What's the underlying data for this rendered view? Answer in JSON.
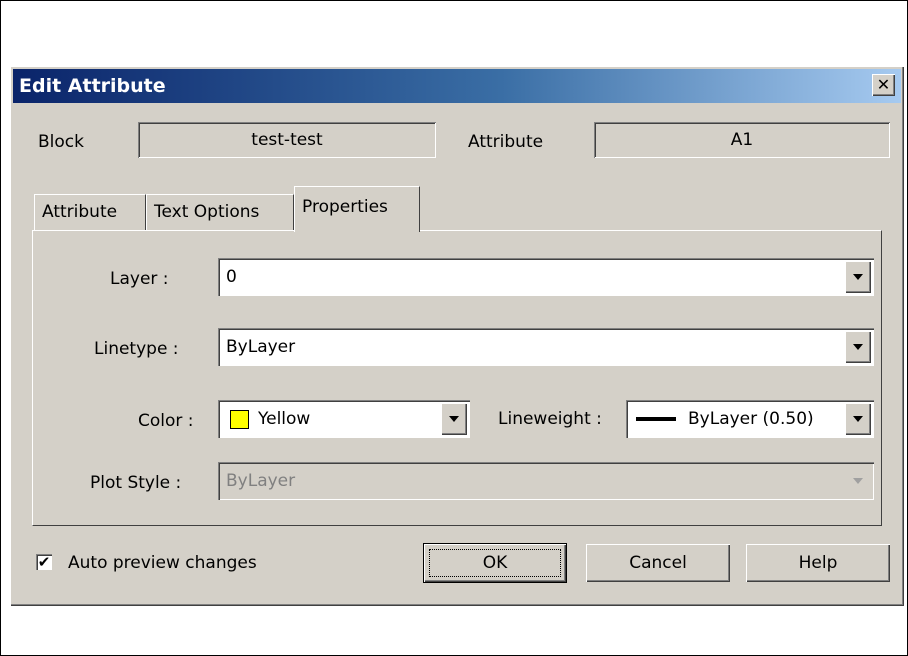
{
  "dialog": {
    "title": "Edit Attribute",
    "close_glyph": "✕"
  },
  "block": {
    "label": "Block",
    "value": "test-test"
  },
  "attribute": {
    "label": "Attribute",
    "value": "A1"
  },
  "tabs": [
    {
      "label": "Attribute",
      "active": false
    },
    {
      "label": "Text Options",
      "active": false
    },
    {
      "label": "Properties",
      "active": true
    }
  ],
  "properties": {
    "layer": {
      "label": "Layer :",
      "value": "0"
    },
    "linetype": {
      "label": "Linetype :",
      "value": "ByLayer"
    },
    "color": {
      "label": "Color :",
      "value": "Yellow",
      "swatch": "#ffff00"
    },
    "lineweight": {
      "label": "Lineweight :",
      "value": "ByLayer (0.50)"
    },
    "plot_style": {
      "label": "Plot Style :",
      "value": "ByLayer",
      "disabled": true
    }
  },
  "footer": {
    "auto_preview": {
      "label": "Auto preview changes",
      "checked": true,
      "check_glyph": "✔"
    },
    "ok_label": "OK",
    "cancel_label": "Cancel",
    "help_label": "Help"
  }
}
